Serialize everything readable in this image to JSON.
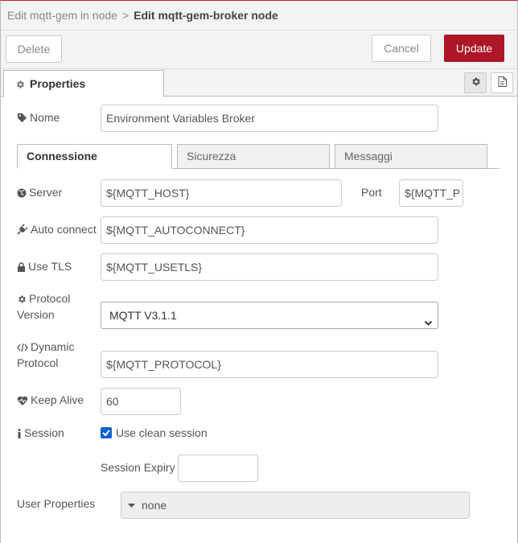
{
  "header": {
    "breadcrumb": "Edit mqtt-gem in node",
    "separator": ">",
    "title": "Edit mqtt-gem-broker node"
  },
  "toolbar": {
    "delete_label": "Delete",
    "cancel_label": "Cancel",
    "update_label": "Update",
    "accent_color": "#ad1625"
  },
  "properties_tab": {
    "label": "Properties"
  },
  "form": {
    "name": {
      "label": "Nome",
      "value": "Environment Variables Broker"
    },
    "tabs": [
      {
        "label": "Connessione",
        "active": true
      },
      {
        "label": "Sicurezza",
        "active": false
      },
      {
        "label": "Messaggi",
        "active": false
      }
    ],
    "server": {
      "label": "Server",
      "value": "${MQTT_HOST}"
    },
    "port": {
      "label": "Port",
      "value": "${MQTT_P"
    },
    "auto_connect": {
      "label": "Auto connect",
      "value": "${MQTT_AUTOCONNECT}"
    },
    "use_tls": {
      "label": "Use TLS",
      "value": "${MQTT_USETLS}"
    },
    "protocol_version": {
      "label_line1": "Protocol",
      "label_line2": "Version",
      "value": "MQTT V3.1.1"
    },
    "dynamic_protocol": {
      "label_line1": "Dynamic",
      "label_line2": "Protocol",
      "value": "${MQTT_PROTOCOL}"
    },
    "keep_alive": {
      "label": "Keep Alive",
      "value": "60"
    },
    "session": {
      "label": "Session",
      "checkbox_label": "Use clean session",
      "checked": true
    },
    "session_expiry": {
      "label": "Session Expiry",
      "value": ""
    },
    "user_properties": {
      "label": "User Properties",
      "value": "none"
    }
  }
}
